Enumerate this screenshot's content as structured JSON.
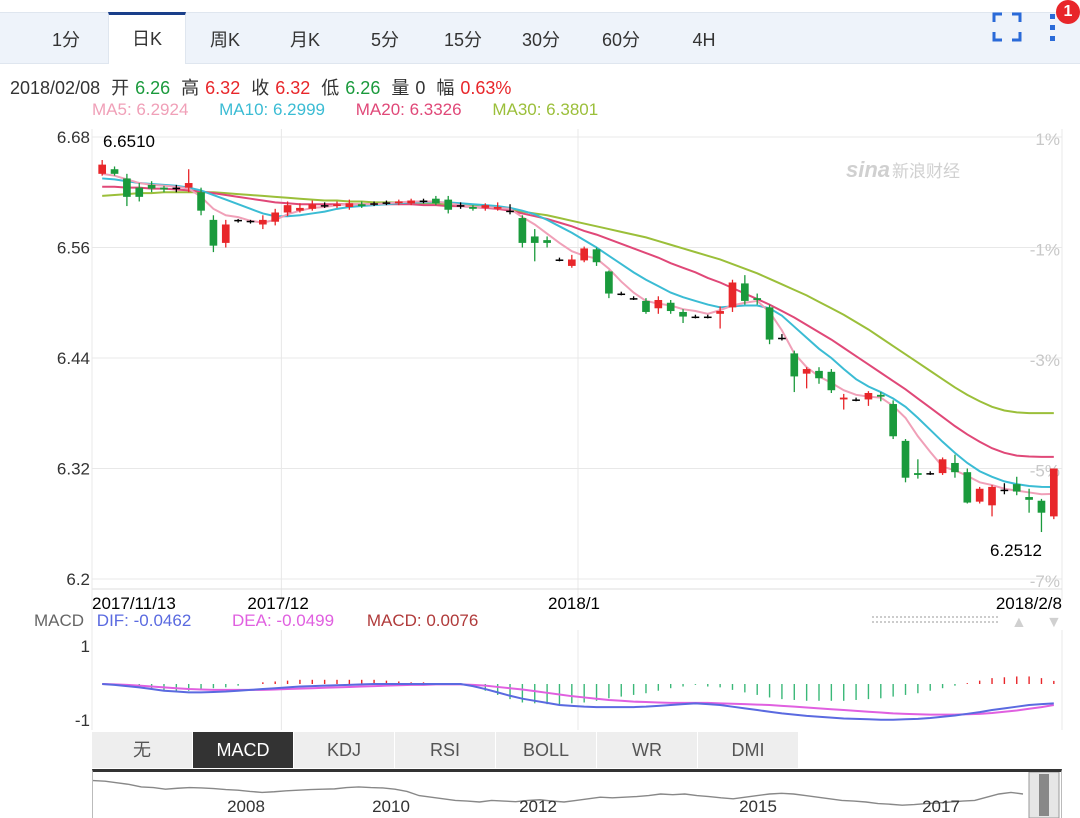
{
  "tabs": [
    "1分",
    "日K",
    "周K",
    "月K",
    "5分",
    "15分",
    "30分",
    "60分",
    "4H"
  ],
  "active_tab": "日K",
  "badge": "1",
  "info": {
    "date": "2018/02/08",
    "open_label": "开",
    "open": "6.26",
    "high_label": "高",
    "high": "6.32",
    "close_label": "收",
    "close": "6.32",
    "low_label": "低",
    "low": "6.26",
    "vol_label": "量",
    "vol": "0",
    "amp_label": "幅",
    "amp": "0.63%"
  },
  "ma": {
    "ma5": "MA5: 6.2924",
    "ma10": "MA10: 6.2999",
    "ma20": "MA20: 6.3326",
    "ma30": "MA30: 6.3801"
  },
  "watermark": "新浪财经",
  "watermark_logo": "sina",
  "macd": {
    "label": "MACD",
    "dif": "DIF: -0.0462",
    "dea": "DEA: -0.0499",
    "macd": "MACD: 0.0076"
  },
  "indicators": [
    "无",
    "MACD",
    "KDJ",
    "RSI",
    "BOLL",
    "WR",
    "DMI"
  ],
  "active_indicator": "MACD",
  "colors": {
    "up": "#e8262a",
    "down": "#1a9a3c",
    "ma5": "#f0a0b8",
    "ma10": "#3bbcd4",
    "ma20": "#e04878",
    "ma30": "#9bbf3a",
    "dif": "#5a6ae0",
    "dea": "#e060e0"
  },
  "chart_data": [
    {
      "type": "candlestick",
      "y_ticks": [
        "6.68",
        "6.56",
        "6.44",
        "6.32",
        "6.2"
      ],
      "y_range": [
        6.2,
        6.68
      ],
      "pct_ticks": [
        "1%",
        "-1%",
        "-3%",
        "-5%",
        "-7%"
      ],
      "x_labels": [
        "2017/11/13",
        "2017/12",
        "2018/1",
        "2018/2/8"
      ],
      "max_label": "6.6510",
      "min_label": "6.2512",
      "candles": [
        {
          "o": 6.64,
          "c": 6.65,
          "h": 6.655,
          "l": 6.638
        },
        {
          "o": 6.645,
          "c": 6.64,
          "h": 6.648,
          "l": 6.638
        },
        {
          "o": 6.635,
          "c": 6.615,
          "h": 6.64,
          "l": 6.605
        },
        {
          "o": 6.625,
          "c": 6.615,
          "h": 6.63,
          "l": 6.61
        },
        {
          "o": 6.628,
          "c": 6.624,
          "h": 6.632,
          "l": 6.62
        },
        {
          "o": 6.625,
          "c": 6.623,
          "h": 6.627,
          "l": 6.62
        },
        {
          "o": 6.625,
          "c": 6.624,
          "h": 6.628,
          "l": 6.62
        },
        {
          "o": 6.625,
          "c": 6.63,
          "h": 6.645,
          "l": 6.62
        },
        {
          "o": 6.62,
          "c": 6.6,
          "h": 6.625,
          "l": 6.595
        },
        {
          "o": 6.59,
          "c": 6.562,
          "h": 6.595,
          "l": 6.555
        },
        {
          "o": 6.565,
          "c": 6.585,
          "h": 6.59,
          "l": 6.56
        },
        {
          "o": 6.59,
          "c": 6.589,
          "h": 6.591,
          "l": 6.587
        },
        {
          "o": 6.588,
          "c": 6.589,
          "h": 6.59,
          "l": 6.586
        },
        {
          "o": 6.585,
          "c": 6.59,
          "h": 6.595,
          "l": 6.58
        },
        {
          "o": 6.588,
          "c": 6.598,
          "h": 6.602,
          "l": 6.584
        },
        {
          "o": 6.598,
          "c": 6.606,
          "h": 6.61,
          "l": 6.594
        },
        {
          "o": 6.6,
          "c": 6.603,
          "h": 6.608,
          "l": 6.598
        },
        {
          "o": 6.602,
          "c": 6.607,
          "h": 6.611,
          "l": 6.6
        },
        {
          "o": 6.605,
          "c": 6.606,
          "h": 6.609,
          "l": 6.603
        },
        {
          "o": 6.605,
          "c": 6.607,
          "h": 6.61,
          "l": 6.603
        },
        {
          "o": 6.604,
          "c": 6.608,
          "h": 6.612,
          "l": 6.601
        },
        {
          "o": 6.607,
          "c": 6.605,
          "h": 6.61,
          "l": 6.603
        },
        {
          "o": 6.607,
          "c": 6.608,
          "h": 6.61,
          "l": 6.605
        },
        {
          "o": 6.608,
          "c": 6.609,
          "h": 6.611,
          "l": 6.606
        },
        {
          "o": 6.608,
          "c": 6.61,
          "h": 6.612,
          "l": 6.606
        },
        {
          "o": 6.608,
          "c": 6.611,
          "h": 6.613,
          "l": 6.606
        },
        {
          "o": 6.61,
          "c": 6.611,
          "h": 6.613,
          "l": 6.608
        },
        {
          "o": 6.613,
          "c": 6.608,
          "h": 6.616,
          "l": 6.606
        },
        {
          "o": 6.612,
          "c": 6.601,
          "h": 6.616,
          "l": 6.597
        },
        {
          "o": 6.606,
          "c": 6.605,
          "h": 6.609,
          "l": 6.602
        },
        {
          "o": 6.604,
          "c": 6.602,
          "h": 6.606,
          "l": 6.6
        },
        {
          "o": 6.603,
          "c": 6.606,
          "h": 6.608,
          "l": 6.6
        },
        {
          "o": 6.602,
          "c": 6.604,
          "h": 6.609,
          "l": 6.6
        },
        {
          "o": 6.6,
          "c": 6.6,
          "h": 6.607,
          "l": 6.596
        },
        {
          "o": 6.592,
          "c": 6.565,
          "h": 6.595,
          "l": 6.56
        },
        {
          "o": 6.572,
          "c": 6.565,
          "h": 6.58,
          "l": 6.545
        },
        {
          "o": 6.568,
          "c": 6.565,
          "h": 6.572,
          "l": 6.56
        },
        {
          "o": 6.547,
          "c": 6.547,
          "h": 6.549,
          "l": 6.545
        },
        {
          "o": 6.54,
          "c": 6.547,
          "h": 6.552,
          "l": 6.538
        },
        {
          "o": 6.546,
          "c": 6.559,
          "h": 6.561,
          "l": 6.544
        },
        {
          "o": 6.558,
          "c": 6.544,
          "h": 6.56,
          "l": 6.54
        },
        {
          "o": 6.534,
          "c": 6.51,
          "h": 6.535,
          "l": 6.505
        },
        {
          "o": 6.51,
          "c": 6.51,
          "h": 6.512,
          "l": 6.508
        },
        {
          "o": 6.505,
          "c": 6.505,
          "h": 6.507,
          "l": 6.503
        },
        {
          "o": 6.502,
          "c": 6.49,
          "h": 6.505,
          "l": 6.488
        },
        {
          "o": 6.494,
          "c": 6.503,
          "h": 6.507,
          "l": 6.488
        },
        {
          "o": 6.5,
          "c": 6.491,
          "h": 6.503,
          "l": 6.488
        },
        {
          "o": 6.49,
          "c": 6.485,
          "h": 6.493,
          "l": 6.478
        },
        {
          "o": 6.485,
          "c": 6.485,
          "h": 6.487,
          "l": 6.483
        },
        {
          "o": 6.485,
          "c": 6.485,
          "h": 6.487,
          "l": 6.483
        },
        {
          "o": 6.488,
          "c": 6.491,
          "h": 6.496,
          "l": 6.472
        },
        {
          "o": 6.495,
          "c": 6.522,
          "h": 6.525,
          "l": 6.49
        },
        {
          "o": 6.521,
          "c": 6.502,
          "h": 6.53,
          "l": 6.498
        },
        {
          "o": 6.505,
          "c": 6.503,
          "h": 6.51,
          "l": 6.498
        },
        {
          "o": 6.495,
          "c": 6.46,
          "h": 6.498,
          "l": 6.455
        },
        {
          "o": 6.462,
          "c": 6.462,
          "h": 6.466,
          "l": 6.459
        },
        {
          "o": 6.445,
          "c": 6.42,
          "h": 6.448,
          "l": 6.403
        },
        {
          "o": 6.423,
          "c": 6.428,
          "h": 6.43,
          "l": 6.407
        },
        {
          "o": 6.426,
          "c": 6.418,
          "h": 6.43,
          "l": 6.412
        },
        {
          "o": 6.425,
          "c": 6.405,
          "h": 6.428,
          "l": 6.402
        },
        {
          "o": 6.395,
          "c": 6.397,
          "h": 6.401,
          "l": 6.384
        },
        {
          "o": 6.395,
          "c": 6.395,
          "h": 6.397,
          "l": 6.393
        },
        {
          "o": 6.395,
          "c": 6.402,
          "h": 6.404,
          "l": 6.388
        },
        {
          "o": 6.4,
          "c": 6.398,
          "h": 6.403,
          "l": 6.393
        },
        {
          "o": 6.39,
          "c": 6.355,
          "h": 6.394,
          "l": 6.352
        },
        {
          "o": 6.35,
          "c": 6.31,
          "h": 6.352,
          "l": 6.305
        },
        {
          "o": 6.315,
          "c": 6.313,
          "h": 6.33,
          "l": 6.309
        },
        {
          "o": 6.315,
          "c": 6.315,
          "h": 6.317,
          "l": 6.313
        },
        {
          "o": 6.315,
          "c": 6.33,
          "h": 6.332,
          "l": 6.313
        },
        {
          "o": 6.326,
          "c": 6.316,
          "h": 6.335,
          "l": 6.31
        },
        {
          "o": 6.316,
          "c": 6.283,
          "h": 6.32,
          "l": 6.282
        },
        {
          "o": 6.284,
          "c": 6.298,
          "h": 6.3,
          "l": 6.282
        },
        {
          "o": 6.28,
          "c": 6.3,
          "h": 6.302,
          "l": 6.268
        },
        {
          "o": 6.296,
          "c": 6.297,
          "h": 6.304,
          "l": 6.292
        },
        {
          "o": 6.303,
          "c": 6.295,
          "h": 6.311,
          "l": 6.291
        },
        {
          "o": 6.289,
          "c": 6.286,
          "h": 6.298,
          "l": 6.272
        },
        {
          "o": 6.285,
          "c": 6.272,
          "h": 6.287,
          "l": 6.251
        },
        {
          "o": 6.268,
          "c": 6.32,
          "h": 6.32,
          "l": 6.265
        }
      ],
      "ma5": [
        6.64,
        6.638,
        6.634,
        6.63,
        6.628,
        6.627,
        6.626,
        6.624,
        6.615,
        6.602,
        6.595,
        6.593,
        6.589,
        6.587,
        6.59,
        6.596,
        6.6,
        6.603,
        6.604,
        6.606,
        6.607,
        6.607,
        6.607,
        6.608,
        6.609,
        6.61,
        6.61,
        6.61,
        6.608,
        6.606,
        6.604,
        6.604,
        6.603,
        6.602,
        6.593,
        6.585,
        6.575,
        6.565,
        6.556,
        6.551,
        6.548,
        6.537,
        6.523,
        6.511,
        6.502,
        6.499,
        6.497,
        6.493,
        6.491,
        6.488,
        6.492,
        6.497,
        6.5,
        6.502,
        6.49,
        6.47,
        6.445,
        6.43,
        6.42,
        6.413,
        6.405,
        6.4,
        6.398,
        6.397,
        6.388,
        6.375,
        6.355,
        6.338,
        6.322,
        6.318,
        6.312,
        6.305,
        6.302,
        6.298,
        6.296,
        6.294,
        6.292,
        6.2924
      ],
      "ma10": [
        6.635,
        6.634,
        6.632,
        6.63,
        6.629,
        6.628,
        6.627,
        6.625,
        6.622,
        6.617,
        6.612,
        6.607,
        6.602,
        6.597,
        6.594,
        6.594,
        6.595,
        6.597,
        6.599,
        6.602,
        6.604,
        6.605,
        6.606,
        6.607,
        6.608,
        6.609,
        6.609,
        6.609,
        6.609,
        6.608,
        6.607,
        6.606,
        6.605,
        6.603,
        6.6,
        6.596,
        6.59,
        6.583,
        6.576,
        6.568,
        6.56,
        6.551,
        6.542,
        6.533,
        6.525,
        6.518,
        6.511,
        6.506,
        6.502,
        6.498,
        6.495,
        6.496,
        6.497,
        6.497,
        6.494,
        6.486,
        6.474,
        6.462,
        6.45,
        6.44,
        6.428,
        6.417,
        6.409,
        6.403,
        6.396,
        6.387,
        6.375,
        6.362,
        6.349,
        6.337,
        6.326,
        6.317,
        6.311,
        6.306,
        6.303,
        6.301,
        6.3,
        6.2999
      ],
      "ma20": [
        6.626,
        6.626,
        6.625,
        6.625,
        6.624,
        6.624,
        6.623,
        6.622,
        6.621,
        6.619,
        6.617,
        6.615,
        6.613,
        6.611,
        6.609,
        6.608,
        6.607,
        6.607,
        6.607,
        6.607,
        6.607,
        6.607,
        6.607,
        6.607,
        6.607,
        6.607,
        6.606,
        6.606,
        6.605,
        6.605,
        6.604,
        6.603,
        6.602,
        6.6,
        6.597,
        6.594,
        6.591,
        6.587,
        6.583,
        6.578,
        6.574,
        6.569,
        6.564,
        6.559,
        6.554,
        6.549,
        6.543,
        6.538,
        6.533,
        6.527,
        6.522,
        6.516,
        6.51,
        6.504,
        6.498,
        6.491,
        6.484,
        6.476,
        6.468,
        6.46,
        6.451,
        6.442,
        6.433,
        6.424,
        6.415,
        6.406,
        6.396,
        6.386,
        6.376,
        6.366,
        6.357,
        6.349,
        6.342,
        6.337,
        6.334,
        6.333,
        6.3326,
        6.3326
      ],
      "ma30": [
        6.616,
        6.617,
        6.618,
        6.619,
        6.619,
        6.62,
        6.62,
        6.62,
        6.62,
        6.62,
        6.619,
        6.618,
        6.617,
        6.616,
        6.615,
        6.614,
        6.613,
        6.612,
        6.611,
        6.611,
        6.61,
        6.61,
        6.609,
        6.609,
        6.609,
        6.609,
        6.608,
        6.608,
        6.607,
        6.606,
        6.605,
        6.604,
        6.603,
        6.601,
        6.599,
        6.597,
        6.595,
        6.592,
        6.589,
        6.586,
        6.583,
        6.58,
        6.577,
        6.574,
        6.571,
        6.567,
        6.563,
        6.559,
        6.555,
        6.551,
        6.547,
        6.542,
        6.537,
        6.532,
        6.526,
        6.52,
        6.514,
        6.508,
        6.501,
        6.494,
        6.487,
        6.479,
        6.471,
        6.462,
        6.453,
        6.444,
        6.435,
        6.426,
        6.417,
        6.408,
        6.4,
        6.393,
        6.387,
        6.383,
        6.381,
        6.3801,
        6.3801,
        6.3801
      ]
    },
    {
      "type": "macd",
      "y_ticks": [
        "1",
        "-1"
      ],
      "dif": [
        0.0,
        -0.002,
        -0.005,
        -0.008,
        -0.012,
        -0.016,
        -0.018,
        -0.02,
        -0.02,
        -0.019,
        -0.018,
        -0.016,
        -0.014,
        -0.012,
        -0.01,
        -0.008,
        -0.006,
        -0.005,
        -0.004,
        -0.003,
        -0.002,
        -0.001,
        0.0,
        0.0,
        0.0,
        0.0,
        0.0,
        0.0,
        0.0,
        0.0,
        -0.005,
        -0.012,
        -0.02,
        -0.028,
        -0.035,
        -0.04,
        -0.045,
        -0.05,
        -0.052,
        -0.054,
        -0.055,
        -0.055,
        -0.055,
        -0.055,
        -0.054,
        -0.052,
        -0.05,
        -0.048,
        -0.046,
        -0.048,
        -0.05,
        -0.054,
        -0.058,
        -0.062,
        -0.066,
        -0.07,
        -0.073,
        -0.076,
        -0.078,
        -0.08,
        -0.082,
        -0.083,
        -0.084,
        -0.085,
        -0.085,
        -0.084,
        -0.083,
        -0.081,
        -0.078,
        -0.075,
        -0.071,
        -0.067,
        -0.062,
        -0.058,
        -0.054,
        -0.05,
        -0.048,
        -0.0462
      ],
      "dea": [
        0.0,
        -0.001,
        -0.002,
        -0.004,
        -0.006,
        -0.008,
        -0.01,
        -0.012,
        -0.013,
        -0.014,
        -0.014,
        -0.014,
        -0.014,
        -0.014,
        -0.013,
        -0.012,
        -0.011,
        -0.01,
        -0.009,
        -0.008,
        -0.007,
        -0.006,
        -0.005,
        -0.004,
        -0.003,
        -0.002,
        -0.002,
        -0.001,
        -0.001,
        -0.001,
        -0.002,
        -0.004,
        -0.007,
        -0.01,
        -0.013,
        -0.017,
        -0.021,
        -0.025,
        -0.029,
        -0.032,
        -0.035,
        -0.038,
        -0.04,
        -0.042,
        -0.043,
        -0.044,
        -0.045,
        -0.045,
        -0.045,
        -0.045,
        -0.046,
        -0.047,
        -0.048,
        -0.049,
        -0.05,
        -0.052,
        -0.054,
        -0.056,
        -0.058,
        -0.06,
        -0.062,
        -0.064,
        -0.066,
        -0.068,
        -0.07,
        -0.071,
        -0.072,
        -0.073,
        -0.073,
        -0.073,
        -0.072,
        -0.071,
        -0.069,
        -0.066,
        -0.063,
        -0.059,
        -0.055,
        -0.0499
      ]
    },
    {
      "type": "line",
      "role": "overview",
      "x_labels": [
        "2008",
        "2010",
        "2012",
        "2015",
        "2017"
      ],
      "values": [
        0.08,
        0.1,
        0.15,
        0.2,
        0.28,
        0.3,
        0.35,
        0.32,
        0.3,
        0.31,
        0.33,
        0.36,
        0.38,
        0.42,
        0.45,
        0.43,
        0.4,
        0.38,
        0.36,
        0.35,
        0.34,
        0.3,
        0.28,
        0.3,
        0.31,
        0.35,
        0.42,
        0.55,
        0.6,
        0.65,
        0.7,
        0.72,
        0.75,
        0.7,
        0.72,
        0.74,
        0.7,
        0.68,
        0.72,
        0.75,
        0.7,
        0.65,
        0.6,
        0.62,
        0.6,
        0.58,
        0.55,
        0.5,
        0.52,
        0.5,
        0.55,
        0.58,
        0.62,
        0.65,
        0.6,
        0.55,
        0.5,
        0.48,
        0.5,
        0.55,
        0.6,
        0.65,
        0.7,
        0.72,
        0.75,
        0.8,
        0.82,
        0.85,
        0.83,
        0.8,
        0.78,
        0.75,
        0.72,
        0.7,
        0.6,
        0.5,
        0.45,
        0.5
      ]
    }
  ]
}
